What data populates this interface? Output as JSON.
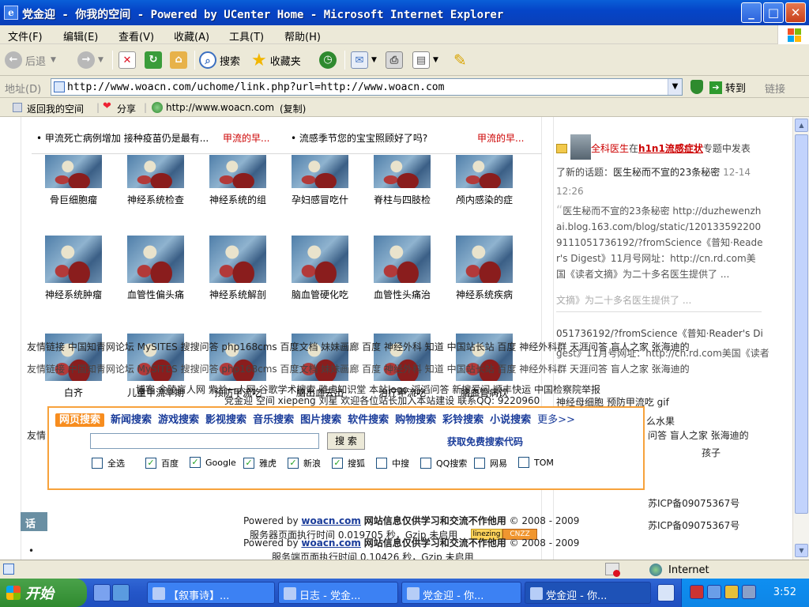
{
  "window": {
    "title": "党金迎 - 你我的空间 - Powered by UCenter Home - Microsoft Internet Explorer"
  },
  "menu": [
    "文件(F)",
    "编辑(E)",
    "查看(V)",
    "收藏(A)",
    "工具(T)",
    "帮助(H)"
  ],
  "toolbar": {
    "back": "后退",
    "search": "搜索",
    "favorites": "收藏夹"
  },
  "address": {
    "label": "地址(D)",
    "url": "http://www.woacn.com/uchome/link.php?url=http://www.woacn.com",
    "go": "转到",
    "links": "链接"
  },
  "sharebar": {
    "back_to_space": "返回我的空间",
    "share": "分享",
    "url": "http://www.woacn.com",
    "copy": "(复制)"
  },
  "news": [
    {
      "text": "• 甲流死亡病例增加 接种疫苗仍是最有...",
      "tag": "甲流的早..."
    },
    {
      "text": "• 流感季节您的宝宝照顾好了吗?",
      "tag": "甲流的早..."
    }
  ],
  "gallery": {
    "row1": [
      "骨巨细胞瘤",
      "神经系统检查",
      "神经系统的组",
      "孕妇感冒吃什",
      "脊柱与四肢检",
      "颅内感染的症"
    ],
    "row2": [
      "神经系统肿瘤",
      "血管性偏头痛",
      "神经系统解剖",
      "脑血管硬化吃",
      "血管性头痛治",
      "神经系统疾病"
    ],
    "row3": [
      "白齐",
      "儿童甲流早期",
      "预防甲流吃",
      "脑出血去出",
      "治疗甲流吃",
      "脑血管病饮"
    ]
  },
  "right": {
    "user": "全科医生",
    "at": "在",
    "topic": "h1n1流感症状",
    "post_suffix": "专题中发表",
    "line2": "了新的话题：",
    "post_title": "医生秘而不宣的23条秘密",
    "post_time": "12-14",
    "post_time2": "12:26",
    "excerpt1": "医生秘而不宣的23条秘密 http://duzhewenzhai.blog.163.com/blog/static/1201335922009111051736192/?fromScience《普知·Reader's Digest》11月号网址：http://cn.rd.com美国《读者文摘》为二十多名医生提供了 ...",
    "excerpt2": "文摘》为二十多名医生提供了 ...",
    "excerpt3": "051736192/?fromScience《普知·Reader's Di",
    "excerpt4": "gest》11月号网址：http://cn.rd.com美国《读者"
  },
  "overlay": {
    "friends1": "友情链接 中国知青网论坛 MySITES 搜搜问答 php168cms 百度文档 妹妹画廊 百度 神经外科 知道 中国站长站 百度 神经外科群 天涯问答 盲人之家 张海迪的",
    "friends2": "友情链接 中国知青网论坛 MySITES 搜搜问答 php168cms 百度文档 妹妹画廊 百度 神经外科 知道 中国站长站 百度 神经外科群 天涯问答 盲人之家 张海迪的",
    "friends3": "博客 金陵盲人网 紫兰一人网 谷歌学术搜索 雅虎知识堂 本站logo 滔滔问答 新搜爱问 顺丰快运 中国检察院举报",
    "friends4": "党金迎 空间 xiepeng 刘星 欢迎各位站长加入本站建设 联系QQ: 9220960",
    "friends5": "友情",
    "misc1": "神经母细胞  预防甲流吃  gif",
    "misc2": "么水果",
    "misc3": "问答 盲人之家 张海迪的",
    "misc4": "孩子",
    "icp1": "苏ICP备09075367号",
    "icp2": "苏ICP备09075367号",
    "topic_label": "话题",
    "bullet": "•"
  },
  "search": {
    "tabs": [
      "网页搜索",
      "新闻搜索",
      "游戏搜索",
      "影视搜索",
      "音乐搜索",
      "图片搜索",
      "软件搜索",
      "购物搜索",
      "彩铃搜索",
      "小说搜索",
      "更多>>"
    ],
    "button": "搜 索",
    "free_code": "获取免费搜索代码",
    "options": [
      {
        "label": "全选",
        "checked": false
      },
      {
        "label": "百度",
        "checked": true
      },
      {
        "label": "Google",
        "checked": true
      },
      {
        "label": "雅虎",
        "checked": true
      },
      {
        "label": "新浪",
        "checked": true
      },
      {
        "label": "搜狐",
        "checked": true
      },
      {
        "label": "中搜",
        "checked": false
      },
      {
        "label": "QQ搜索",
        "checked": false
      },
      {
        "label": "网易",
        "checked": false
      },
      {
        "label": "TOM",
        "checked": false
      }
    ]
  },
  "footer": {
    "powered_prefix": "Powered by",
    "site": "woacn.com",
    "powered_suffix": "网站信息仅供学习和交流不作他用",
    "copyright": "© 2008 - 2009",
    "exec1": "服务器页面执行时间 0.019705 秒，Gzip 未启用",
    "exec2": "服务端页面执行时间 0.10426 秒，Gzip 未启用",
    "badge1": "linezing",
    "badge2": "CNZZ"
  },
  "status": {
    "zone": "Internet"
  },
  "taskbar": {
    "start": "开始",
    "tasks": [
      "【叙事诗】...",
      "日志 - 党金...",
      "党金迎 - 你...",
      "党金迎 - 你..."
    ],
    "clock": "3:52"
  }
}
